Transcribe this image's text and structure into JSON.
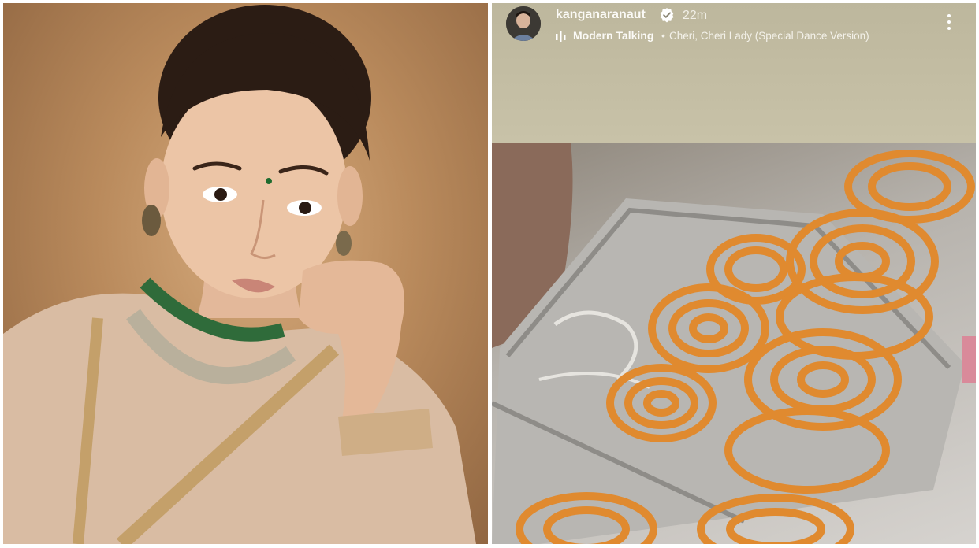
{
  "story": {
    "username": "kanganaranaut",
    "time_ago": "22m",
    "music": {
      "artist": "Modern Talking",
      "separator": "•",
      "track": "Cheri, Cheri Lady (Special Dance Version)"
    }
  },
  "icons": {
    "verified": "verified-badge-icon",
    "music": "music-bars-icon",
    "more": "more-vertical-icon"
  },
  "colors": {
    "verified_badge": "#ffffff",
    "jalebi": "#e08a2f",
    "backdrop": "#b98a5c"
  }
}
